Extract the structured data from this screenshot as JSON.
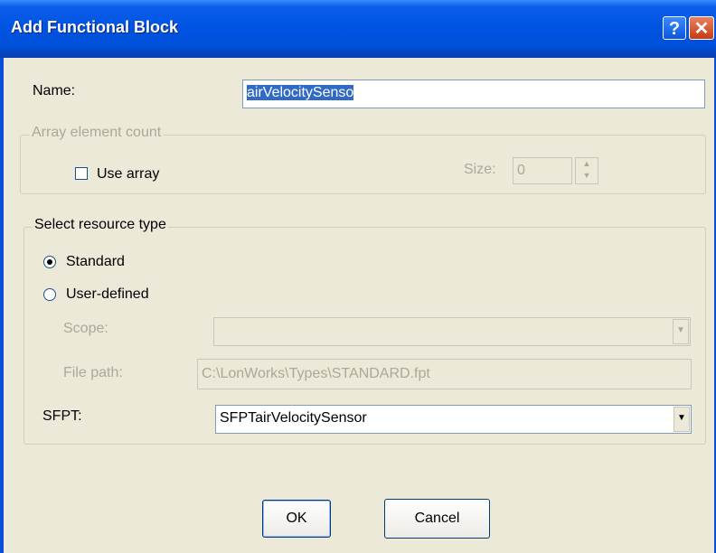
{
  "window": {
    "title": "Add Functional Block",
    "help_label": "?",
    "close_label": "✕"
  },
  "name": {
    "label": "Name:",
    "value": "airVelocitySenso"
  },
  "array_group": {
    "label": "Array element count",
    "use_array_label": "Use array",
    "use_array_checked": false,
    "size_label": "Size:",
    "size_value": "0"
  },
  "resource_group": {
    "label": "Select resource type",
    "options": [
      {
        "label": "Standard",
        "selected": true
      },
      {
        "label": "User-defined",
        "selected": false
      }
    ],
    "scope_label": "Scope:",
    "scope_value": "",
    "file_path_label": "File path:",
    "file_path_value": "C:\\LonWorks\\Types\\STANDARD.fpt",
    "sfpt_label": "SFPT:",
    "sfpt_value": "SFPTairVelocitySensor"
  },
  "buttons": {
    "ok": "OK",
    "cancel": "Cancel"
  },
  "icons": {
    "dropdown": "▼",
    "spin_up": "▲",
    "spin_down": "▼"
  },
  "colors": {
    "titlebar": "#0054e3",
    "selection": "#316ac5",
    "face": "#ece9d8"
  }
}
